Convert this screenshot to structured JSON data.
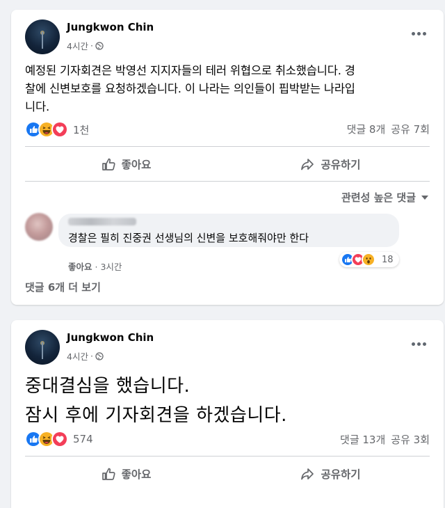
{
  "colors": {
    "background": "#f0f2f5",
    "card": "#ffffff",
    "secondary_text": "#65676b",
    "like_blue": "#1877f2",
    "love_red": "#f33e58",
    "haha_yellow": "#f7b125"
  },
  "posts": [
    {
      "author": "Jungkwon Chin",
      "time": "4시간",
      "dot": "·",
      "privacy_icon": "globe-icon",
      "text": "예정된 기자회견은 박영선 지지자들의 테러 위협으로 취소했습니다. 경\n찰에 신변보호를 요청하겠습니다. 이 나라는 의인들이 핍박받는 나라입\n니다.",
      "reaction_icons": [
        "like-icon",
        "haha-icon",
        "love-icon"
      ],
      "reaction_count": "1천",
      "comments": "댓글 8개",
      "shares": "공유 7회",
      "like_label": "좋아요",
      "share_label": "공유하기",
      "sort_label": "관련성 높은 댓글",
      "top_comment": {
        "text": "경찰은 필히 진중권 선생님의 신변을 보호해줘야만 한다",
        "like_label": "좋아요",
        "time": "3시간",
        "reaction_icons": [
          "like-icon",
          "love-icon",
          "wow-icon"
        ],
        "reaction_count": "18"
      },
      "more_comments": "댓글 6개 더 보기"
    },
    {
      "author": "Jungkwon Chin",
      "time": "4시간",
      "dot": "·",
      "privacy_icon": "globe-icon",
      "text": "중대결심을 했습니다.\n잠시 후에 기자회견을 하겠습니다.",
      "reaction_icons": [
        "like-icon",
        "haha-icon",
        "love-icon"
      ],
      "reaction_count": "574",
      "comments": "댓글 13개",
      "shares": "공유 3회",
      "like_label": "좋아요",
      "share_label": "공유하기"
    }
  ]
}
